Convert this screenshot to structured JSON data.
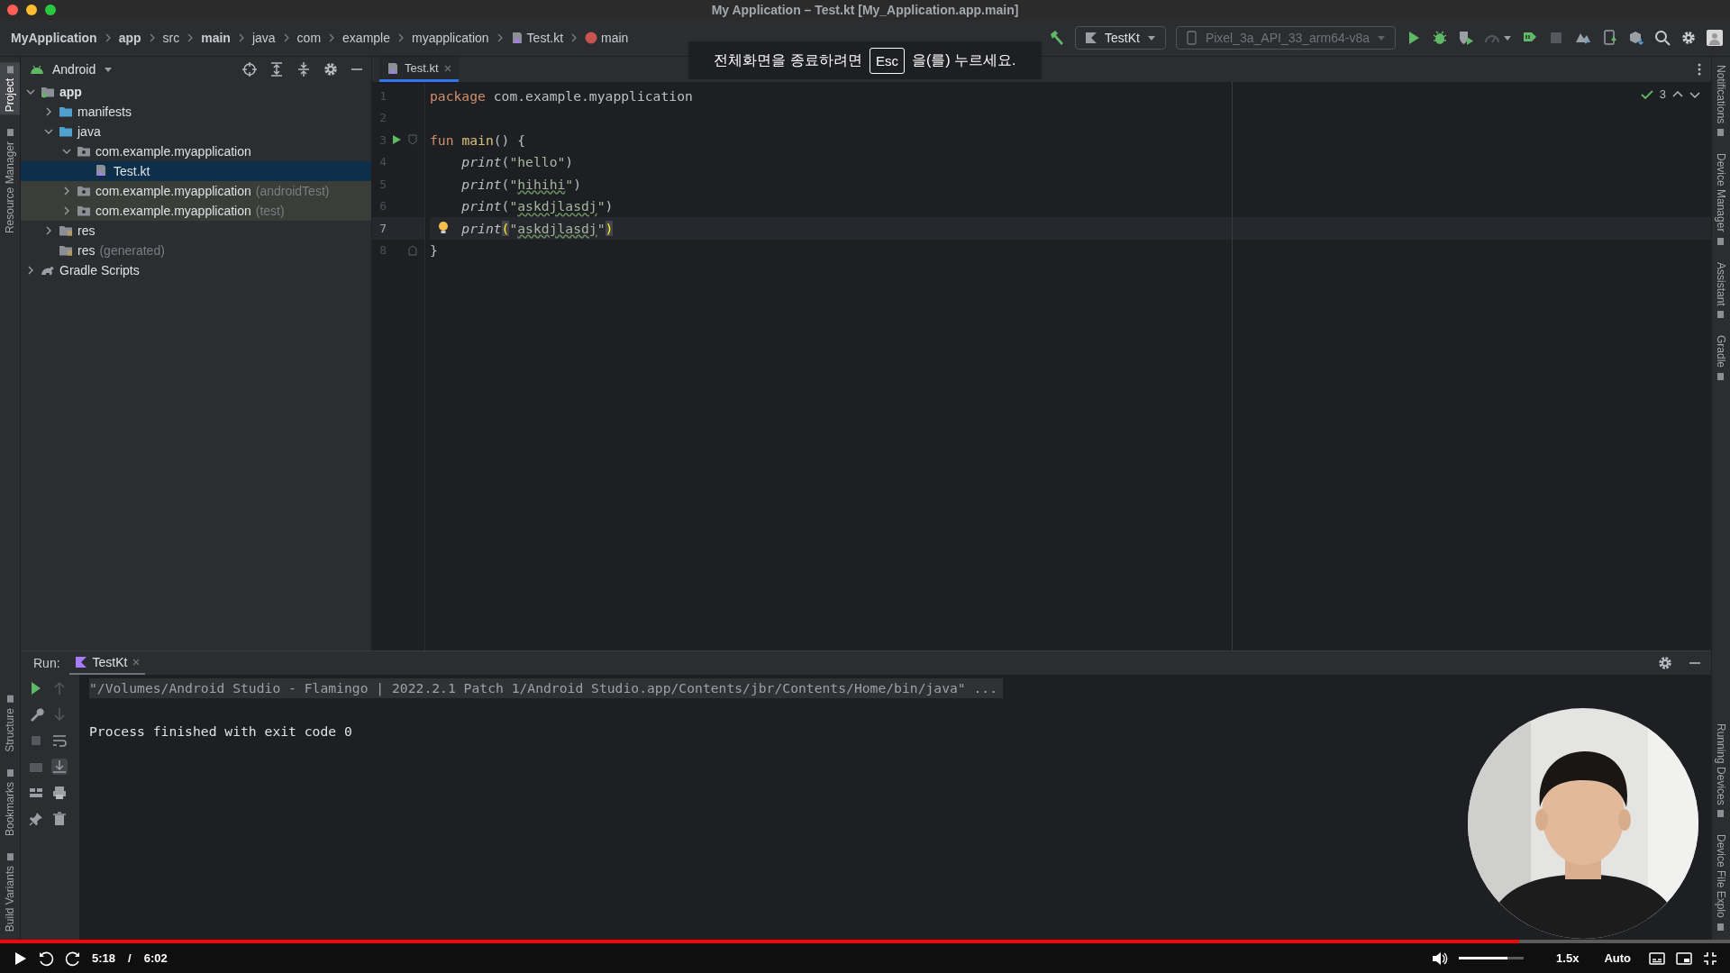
{
  "window": {
    "title": "My Application – Test.kt [My_Application.app.main]"
  },
  "breadcrumbs": [
    {
      "label": "MyApplication",
      "bold": true,
      "kind": "plain"
    },
    {
      "label": "app",
      "bold": true,
      "kind": "plain"
    },
    {
      "label": "src",
      "bold": false,
      "kind": "plain"
    },
    {
      "label": "main",
      "bold": true,
      "kind": "plain"
    },
    {
      "label": "java",
      "bold": false,
      "kind": "plain"
    },
    {
      "label": "com",
      "bold": false,
      "kind": "plain"
    },
    {
      "label": "example",
      "bold": false,
      "kind": "plain"
    },
    {
      "label": "myapplication",
      "bold": false,
      "kind": "plain"
    },
    {
      "label": "Test.kt",
      "bold": false,
      "kind": "kotlin"
    },
    {
      "label": "main",
      "bold": false,
      "kind": "function"
    }
  ],
  "toolbar": {
    "run_config": "TestKt",
    "device": "Pixel_3a_API_33_arm64-v8a",
    "actions": [
      {
        "kind": "run",
        "disabled": false
      },
      {
        "kind": "debug",
        "disabled": false
      },
      {
        "kind": "coverage",
        "disabled": false
      },
      {
        "kind": "profile",
        "disabled": true
      },
      {
        "kind": "apply",
        "disabled": false
      },
      {
        "kind": "stop",
        "disabled": true
      }
    ]
  },
  "fullscreen_notice": {
    "before": "전체화면을 종료하려면",
    "key": "Esc",
    "after": "을(를) 누르세요."
  },
  "left_strip": {
    "top": [
      {
        "label": "Project",
        "selected": true
      },
      {
        "label": "Resource Manager",
        "selected": false
      }
    ],
    "bottom": [
      {
        "label": "Structure",
        "selected": false
      },
      {
        "label": "Bookmarks",
        "selected": false
      },
      {
        "label": "Build Variants",
        "selected": false
      }
    ]
  },
  "right_strip": {
    "top": [
      {
        "label": "Notifications"
      },
      {
        "label": "Device Manager"
      },
      {
        "label": "Assistant"
      },
      {
        "label": "Gradle"
      }
    ],
    "bottom": [
      {
        "label": "Running Devices"
      },
      {
        "label": "Device File Explo"
      }
    ]
  },
  "project": {
    "view": "Android",
    "tree": [
      {
        "label": "app",
        "kind": "module",
        "bold": true,
        "expanded": true,
        "selected": false,
        "tinted": false,
        "children": [
          {
            "label": "manifests",
            "kind": "folder",
            "bold": false,
            "expanded": false,
            "selected": false,
            "tinted": false
          },
          {
            "label": "java",
            "kind": "folder",
            "bold": false,
            "expanded": true,
            "selected": false,
            "tinted": false,
            "children": [
              {
                "label": "com.example.myapplication",
                "kind": "package",
                "bold": false,
                "expanded": true,
                "selected": false,
                "tinted": false,
                "children": [
                  {
                    "label": "Test.kt",
                    "kind": "kotlin",
                    "bold": false,
                    "selected": true,
                    "tinted": false
                  }
                ]
              },
              {
                "label": "com.example.myapplication",
                "suffix": "(androidTest)",
                "kind": "package",
                "bold": false,
                "expanded": false,
                "selected": false,
                "tinted": true
              },
              {
                "label": "com.example.myapplication",
                "suffix": "(test)",
                "kind": "package",
                "bold": false,
                "expanded": false,
                "selected": false,
                "tinted": true
              }
            ]
          },
          {
            "label": "res",
            "kind": "res",
            "bold": false,
            "expanded": false,
            "selected": false,
            "tinted": false
          },
          {
            "label": "res",
            "suffix": "(generated)",
            "kind": "res",
            "bold": false,
            "selected": false,
            "tinted": false
          }
        ]
      },
      {
        "label": "Gradle Scripts",
        "kind": "gradle",
        "bold": false,
        "expanded": false,
        "selected": false,
        "tinted": false
      }
    ]
  },
  "editor": {
    "tabs": [
      {
        "label": "Test.kt",
        "selected": true
      }
    ],
    "inspections": "3",
    "lines": [
      {
        "number": "1",
        "current": false,
        "run": false,
        "bulb": false,
        "fold_start": false,
        "fold_end": false,
        "tokens": [
          {
            "text": "package",
            "kind": "keyword"
          },
          {
            "text": " com.example.myapplication",
            "kind": "plain"
          }
        ]
      },
      {
        "number": "2",
        "current": false,
        "run": false,
        "bulb": false,
        "fold_start": false,
        "fold_end": false
      },
      {
        "number": "3",
        "current": false,
        "run": true,
        "bulb": false,
        "fold_start": true,
        "fold_end": false,
        "tokens": [
          {
            "text": "fun ",
            "kind": "keyword"
          },
          {
            "text": "main",
            "kind": "function"
          },
          {
            "text": "() {",
            "kind": "plain"
          }
        ]
      },
      {
        "number": "4",
        "current": false,
        "run": false,
        "bulb": false,
        "fold_start": false,
        "fold_end": false,
        "tokens": [
          {
            "text": "    print",
            "kind": "call"
          },
          {
            "text": "(",
            "kind": "plain"
          },
          {
            "text": "\"hello\"",
            "kind": "string"
          },
          {
            "text": ")",
            "kind": "plain"
          }
        ]
      },
      {
        "number": "5",
        "current": false,
        "run": false,
        "bulb": false,
        "fold_start": false,
        "fold_end": false,
        "tokens": [
          {
            "text": "    print",
            "kind": "call"
          },
          {
            "text": "(",
            "kind": "plain"
          },
          {
            "text": "\"",
            "kind": "string"
          },
          {
            "text": "hihihi",
            "kind": "typo"
          },
          {
            "text": "\"",
            "kind": "string"
          },
          {
            "text": ")",
            "kind": "plain"
          }
        ]
      },
      {
        "number": "6",
        "current": false,
        "run": false,
        "bulb": false,
        "fold_start": false,
        "fold_end": false,
        "tokens": [
          {
            "text": "    print",
            "kind": "call"
          },
          {
            "text": "(",
            "kind": "plain"
          },
          {
            "text": "\"",
            "kind": "string"
          },
          {
            "text": "askdjlasdj",
            "kind": "typo"
          },
          {
            "text": "\"",
            "kind": "string"
          },
          {
            "text": ")",
            "kind": "plain"
          }
        ]
      },
      {
        "number": "7",
        "current": true,
        "run": false,
        "bulb": true,
        "fold_start": false,
        "fold_end": false,
        "tokens": [
          {
            "text": "    print",
            "kind": "call"
          },
          {
            "text": "(",
            "kind": "matched"
          },
          {
            "text": "\"",
            "kind": "string"
          },
          {
            "text": "askdjlasdj",
            "kind": "typo"
          },
          {
            "text": "\"",
            "kind": "string"
          },
          {
            "text": ")",
            "kind": "matched"
          }
        ]
      },
      {
        "number": "8",
        "current": false,
        "run": false,
        "bulb": false,
        "fold_start": false,
        "fold_end": true,
        "tokens": [
          {
            "text": "}",
            "kind": "plain"
          }
        ]
      }
    ]
  },
  "run": {
    "label": "Run:",
    "tabs": [
      {
        "label": "TestKt",
        "selected": true
      }
    ],
    "output": [
      {
        "text": "\"/Volumes/Android Studio - Flamingo | 2022.2.1 Patch 1/Android Studio.app/Contents/jbr/Contents/Home/bin/java\" ...",
        "kind": "command"
      },
      {
        "text": "Process finished with exit code 0",
        "kind": "result"
      }
    ]
  },
  "video": {
    "current": "5:18",
    "separator": "/",
    "duration": "6:02",
    "progress": {
      "level": 0.878
    },
    "volume": {
      "level": 0.75
    },
    "speed": "1.5x",
    "quality": "Auto"
  }
}
